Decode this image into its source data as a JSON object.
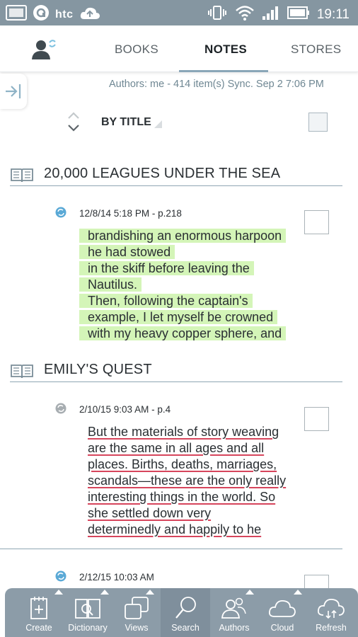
{
  "status_bar": {
    "carrier_brand": "htc",
    "time": "19:11",
    "icons": [
      "message-icon",
      "htc-logo-icon",
      "cloud-upload-icon",
      "vibrate-icon",
      "wifi-icon",
      "signal-icon",
      "battery-icon"
    ]
  },
  "tabs": {
    "user_icon": "user-sync-icon",
    "items": [
      {
        "label": "BOOKS",
        "active": false
      },
      {
        "label": "NOTES",
        "active": true
      },
      {
        "label": "STORES",
        "active": false
      }
    ],
    "accent": "#8aa6b8"
  },
  "sync_info": "Authors: me - 414 item(s) Sync. Sep 2 7:06 PM",
  "sort": {
    "label": "BY TITLE"
  },
  "books": [
    {
      "title": "20,000 LEAGUES UNDER THE SEA",
      "notes": [
        {
          "meta": "12/8/14 5:18 PM  - p.218",
          "synced": true,
          "style": "highlight",
          "highlight_color": "#d4f5b8",
          "lines": [
            "brandishing an enormous harpoon",
            "he had stowed",
            "in the skiff before leaving the",
            "Nautilus.",
            " Then, following the captain's",
            "example, I let myself be crowned",
            "with my heavy copper sphere, and"
          ]
        }
      ]
    },
    {
      "title": "EMILY'S QUEST",
      "notes": [
        {
          "meta": "2/10/15 9:03 AM  - p.4",
          "synced": false,
          "style": "underline",
          "underline_color": "#d6455c",
          "lines": [
            "But the materials of story weaving",
            "are the same in all ages and all",
            "places. Births, deaths, marriages,",
            "scandals—these are the only really",
            "interesting things in the world. So",
            "she settled down very",
            "determinedly and happily to he"
          ]
        },
        {
          "meta": "2/12/15 10:03 AM",
          "synced": true
        }
      ]
    }
  ],
  "toolbar": {
    "items": [
      {
        "label": "Create",
        "icon": "create-note-icon"
      },
      {
        "label": "Dictionary",
        "icon": "dictionary-icon"
      },
      {
        "label": "Views",
        "icon": "views-icon"
      },
      {
        "label": "Search",
        "icon": "search-icon"
      },
      {
        "label": "Authors",
        "icon": "authors-icon"
      },
      {
        "label": "Cloud",
        "icon": "cloud-icon"
      },
      {
        "label": "Refresh",
        "icon": "refresh-cloud-icon"
      }
    ]
  }
}
